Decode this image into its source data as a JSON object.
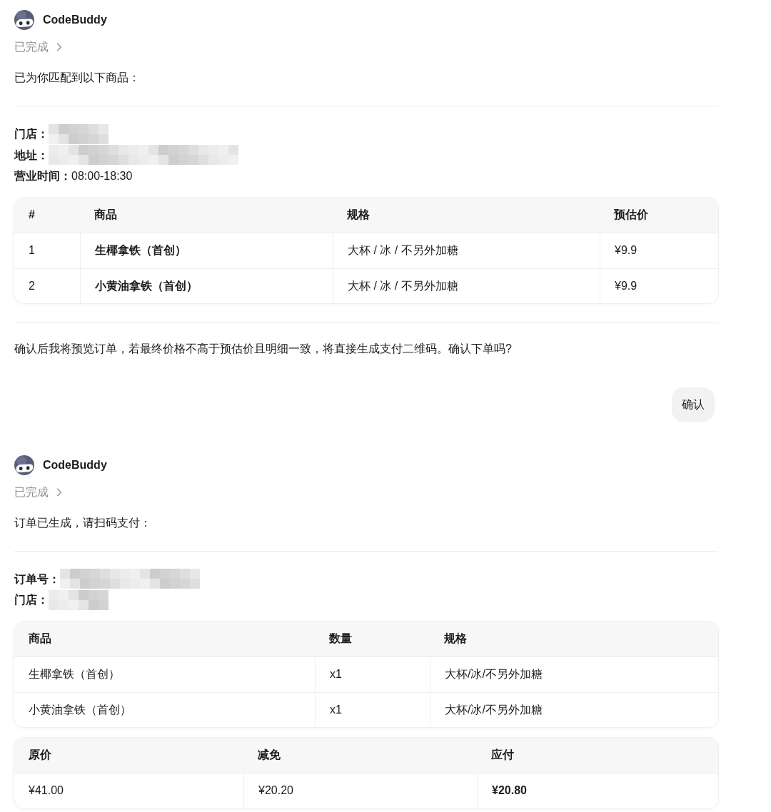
{
  "messages": [
    {
      "kind": "assistant",
      "sender": "CodeBuddy",
      "status": {
        "label": "已完成",
        "expanded": false
      },
      "blocks": [
        {
          "kind": "text",
          "text": "已为你匹配到以下商品："
        },
        {
          "kind": "divider"
        },
        {
          "kind": "fields",
          "items": [
            {
              "label": "门店：",
              "redacted": true
            },
            {
              "label": "地址：",
              "redacted": true
            },
            {
              "label": "营业时间：",
              "value": "08:00-18:30"
            }
          ]
        },
        {
          "kind": "table",
          "columns": [
            {
              "label": "#",
              "emphasis": false
            },
            {
              "label": "商品",
              "emphasis": true
            },
            {
              "label": "规格",
              "emphasis": false
            },
            {
              "label": "预估价",
              "emphasis": false
            }
          ],
          "rows": [
            [
              "1",
              "生椰拿铁（首创）",
              "大杯 / 冰 / 不另外加糖",
              "¥9.9"
            ],
            [
              "2",
              "小黄油拿铁（首创）",
              "大杯 / 冰 / 不另外加糖",
              "¥9.9"
            ]
          ]
        },
        {
          "kind": "divider"
        },
        {
          "kind": "text",
          "text": "确认后我将预览订单，若最终价格不高于预估价且明细一致，将直接生成支付二维码。确认下单吗?"
        }
      ]
    },
    {
      "kind": "user",
      "text": "确认"
    },
    {
      "kind": "assistant",
      "sender": "CodeBuddy",
      "status": {
        "label": "已完成",
        "expanded": false
      },
      "blocks": [
        {
          "kind": "text",
          "text": "订单已生成，请扫码支付："
        },
        {
          "kind": "divider"
        },
        {
          "kind": "fields",
          "items": [
            {
              "label": "订单号：",
              "redacted": true
            },
            {
              "label": "门店：",
              "redacted": true
            }
          ]
        },
        {
          "kind": "table",
          "columns": [
            {
              "label": "商品",
              "emphasis": false
            },
            {
              "label": "数量",
              "emphasis": false
            },
            {
              "label": "规格",
              "emphasis": false
            }
          ],
          "rows": [
            [
              "生椰拿铁（首创）",
              "x1",
              "大杯/冰/不另外加糖"
            ],
            [
              "小黄油拿铁（首创）",
              "x1",
              "大杯/冰/不另外加糖"
            ]
          ]
        },
        {
          "kind": "table",
          "columns": [
            {
              "label": "原价",
              "emphasis": false
            },
            {
              "label": "减免",
              "emphasis": false
            },
            {
              "label": "应付",
              "emphasis": true
            }
          ],
          "rows": [
            [
              "¥41.00",
              "¥20.20",
              "¥20.80"
            ]
          ]
        }
      ]
    }
  ]
}
